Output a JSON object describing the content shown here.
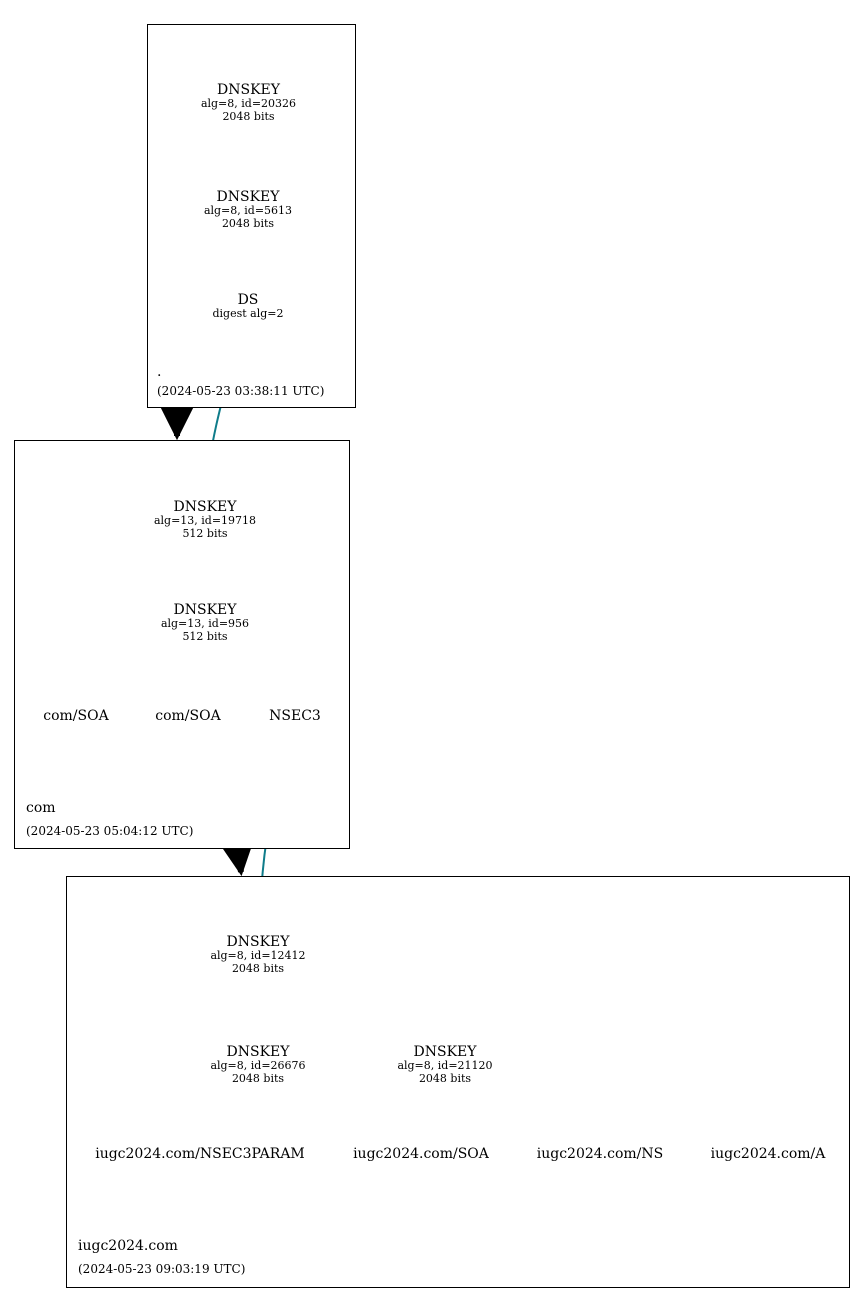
{
  "zones": {
    "root": {
      "name": ".",
      "timestamp": "(2024-05-23 03:38:11 UTC)",
      "nodes": {
        "dnskey1": {
          "title": "DNSKEY",
          "sub1": "alg=8, id=20326",
          "sub2": "2048 bits"
        },
        "dnskey2": {
          "title": "DNSKEY",
          "sub1": "alg=8, id=5613",
          "sub2": "2048 bits"
        },
        "ds": {
          "title": "DS",
          "sub1": "digest alg=2"
        }
      }
    },
    "com": {
      "name": "com",
      "timestamp": "(2024-05-23 05:04:12 UTC)",
      "nodes": {
        "dnskey1": {
          "title": "DNSKEY",
          "sub1": "alg=13, id=19718",
          "sub2": "512 bits"
        },
        "dnskey2": {
          "title": "DNSKEY",
          "sub1": "alg=13, id=956",
          "sub2": "512 bits"
        },
        "soa1": {
          "title": "com/SOA"
        },
        "soa2": {
          "title": "com/SOA"
        },
        "nsec3": {
          "title": "NSEC3"
        }
      }
    },
    "iugc": {
      "name": "iugc2024.com",
      "timestamp": "(2024-05-23 09:03:19 UTC)",
      "nodes": {
        "dnskey1": {
          "title": "DNSKEY",
          "sub1": "alg=8, id=12412",
          "sub2": "2048 bits"
        },
        "dnskey2": {
          "title": "DNSKEY",
          "sub1": "alg=8, id=26676",
          "sub2": "2048 bits"
        },
        "dnskey3": {
          "title": "DNSKEY",
          "sub1": "alg=8, id=21120",
          "sub2": "2048 bits"
        },
        "rr1": {
          "title": "iugc2024.com/NSEC3PARAM"
        },
        "rr2": {
          "title": "iugc2024.com/SOA"
        },
        "rr3": {
          "title": "iugc2024.com/NS"
        },
        "rr4": {
          "title": "iugc2024.com/A"
        }
      }
    }
  },
  "colors": {
    "teal": "#0f7c8a",
    "black": "#000000",
    "gray": "#d9d9d9"
  }
}
